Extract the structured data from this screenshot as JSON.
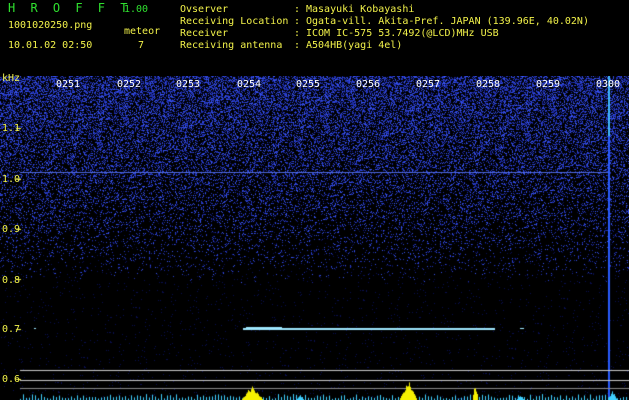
{
  "app": {
    "logo": "H R O F F T",
    "version": "1.00",
    "filename": "1001020250.png",
    "datetime": "10.01.02 02:50",
    "meteor_label": "meteor",
    "meteor_count": "7"
  },
  "info": [
    {
      "key": "Ovserver",
      "value": "Masayuki Kobayashi"
    },
    {
      "key": "Receiving Location",
      "value": "Ogata-vill. Akita-Pref. JAPAN (139.96E, 40.02N)"
    },
    {
      "key": "Receiver",
      "value": "ICOM IC-575 53.7492(@LCD)MHz USB"
    },
    {
      "key": "Receiving antenna",
      "value": "A504HB(yagi 4el)"
    }
  ],
  "axis": {
    "unit": "kHz",
    "y_ticks": [
      "1.1",
      "1.0",
      "0.9",
      "0.8",
      "0.7",
      "0.6"
    ],
    "time_labels": [
      "0251",
      "0252",
      "0253",
      "0254",
      "0255",
      "0256",
      "0257",
      "0258",
      "0259",
      "0300"
    ]
  },
  "colors": {
    "text_green": "#2fe02f",
    "text_yellow": "#f2f24a",
    "noise_blue": "#2a3cd8",
    "meteor_cyan": "#7fe8ff",
    "meteor_yellow": "#f5f000"
  }
}
